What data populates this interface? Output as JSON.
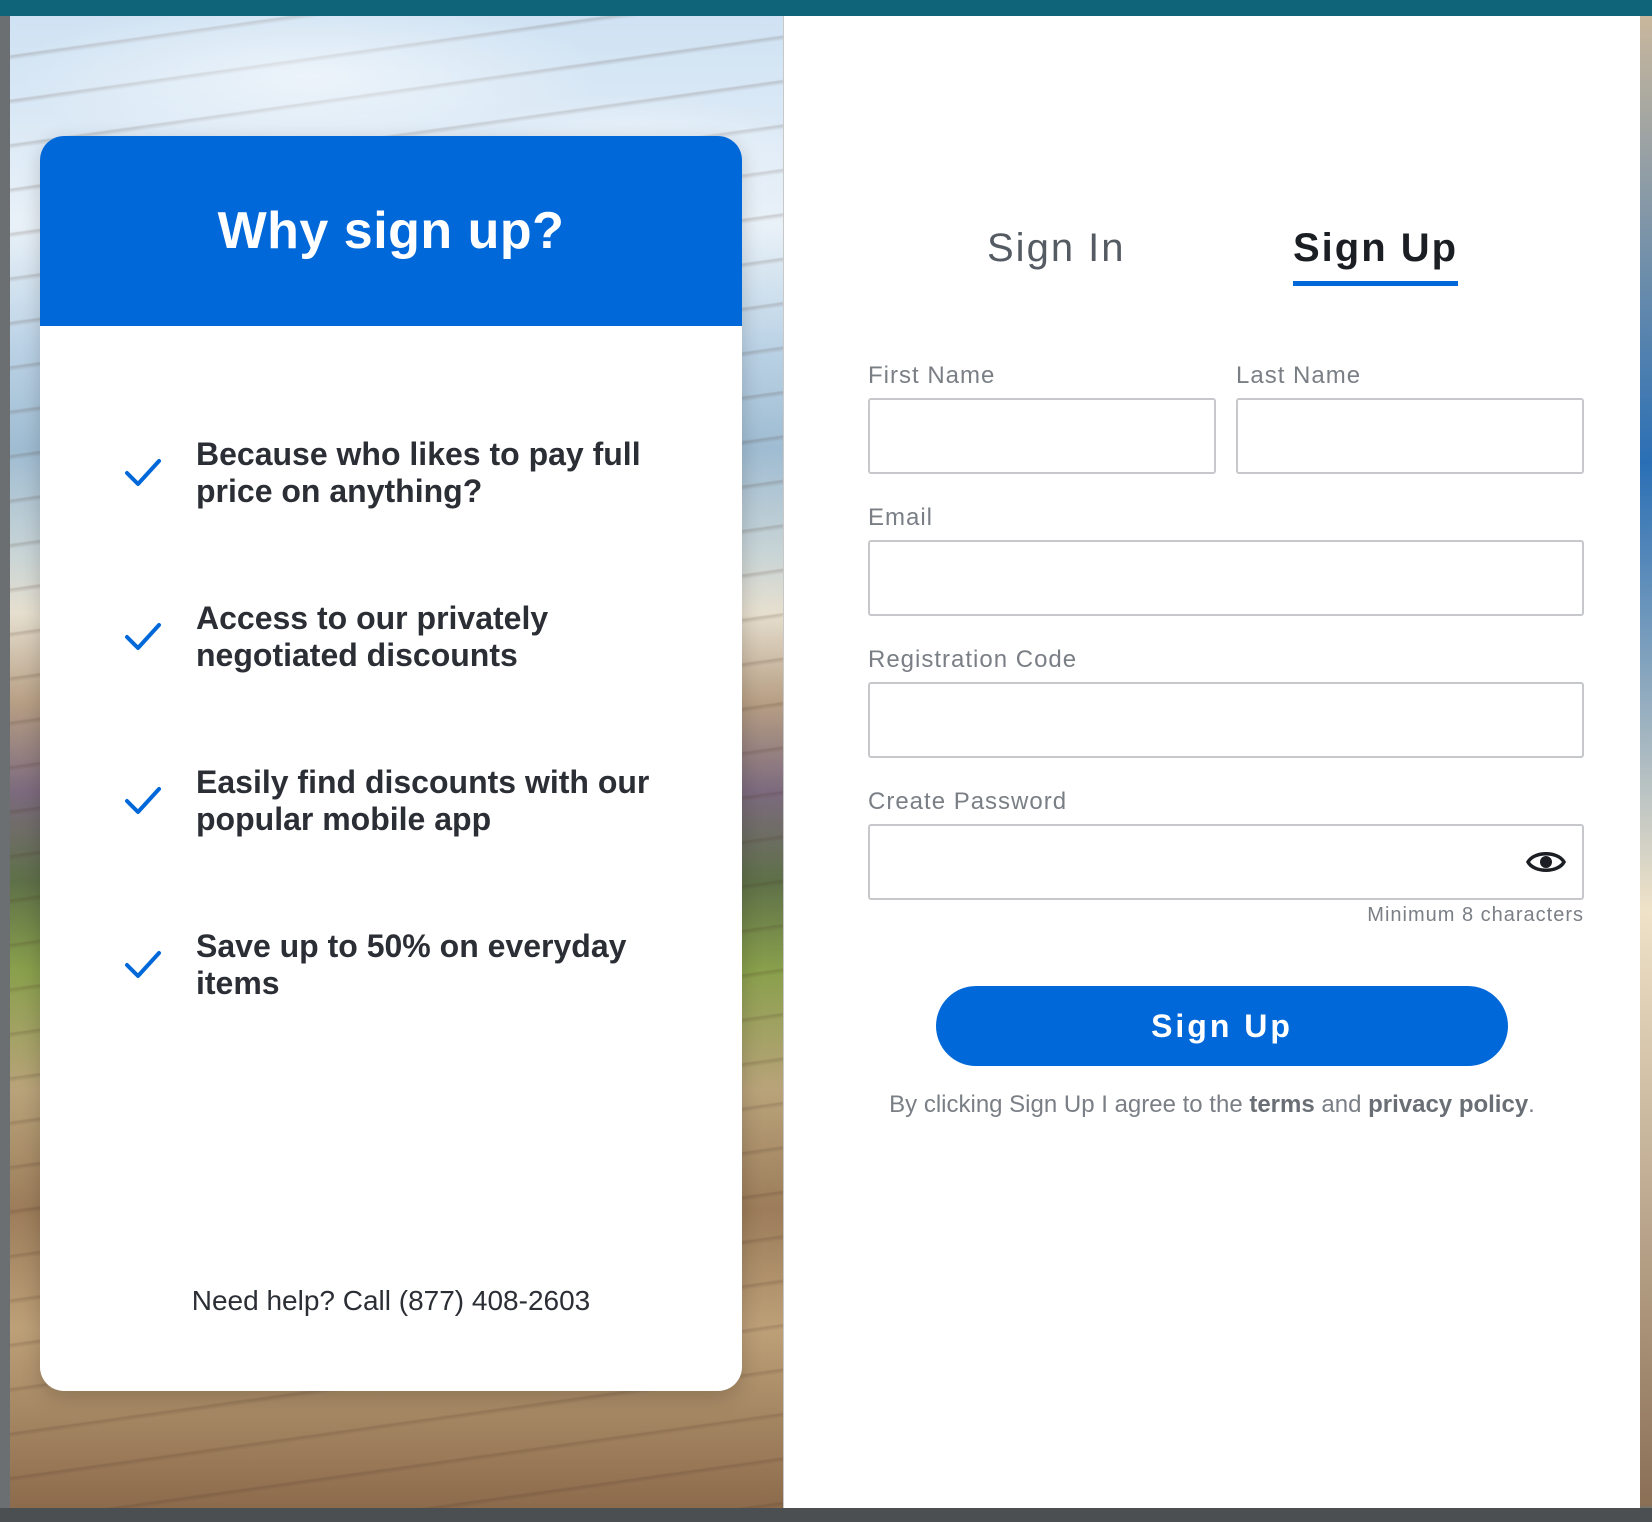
{
  "why": {
    "title": "Why sign up?",
    "benefits": [
      "Because who likes to pay full price on anything?",
      "Access to our privately negotiated discounts",
      "Easily find discounts with our popular mobile app",
      "Save up to 50% on everyday items"
    ],
    "help": "Need help? Call (877) 408-2603"
  },
  "tabs": {
    "sign_in": "Sign In",
    "sign_up": "Sign Up",
    "active": "sign_up"
  },
  "form": {
    "first_name_label": "First Name",
    "last_name_label": "Last Name",
    "email_label": "Email",
    "reg_code_label": "Registration Code",
    "password_label": "Create Password",
    "password_hint": "Minimum 8 characters",
    "first_name_value": "",
    "last_name_value": "",
    "email_value": "",
    "reg_code_value": "",
    "password_value": ""
  },
  "submit_label": "Sign Up",
  "agree": {
    "prefix": "By clicking Sign Up I agree to the ",
    "terms": "terms",
    "and": " and ",
    "privacy": "privacy policy",
    "suffix": "."
  },
  "colors": {
    "brand_blue": "#0068d9",
    "text_dark": "#2b2f35",
    "text_muted": "#7a7f86"
  },
  "icons": [
    "checkmark-icon",
    "eye-icon"
  ]
}
